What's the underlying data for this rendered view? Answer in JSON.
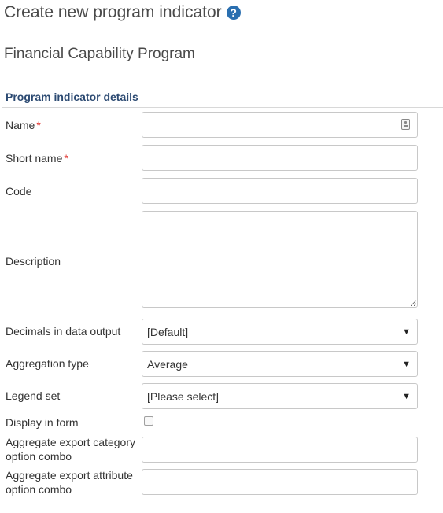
{
  "header": {
    "title": "Create new program indicator",
    "help_icon_glyph": "?"
  },
  "program": {
    "name": "Financial Capability Program"
  },
  "section": {
    "title": "Program indicator details"
  },
  "form": {
    "name": {
      "label": "Name",
      "required_mark": "*",
      "value": ""
    },
    "short_name": {
      "label": "Short name",
      "required_mark": "*",
      "value": ""
    },
    "code": {
      "label": "Code",
      "value": ""
    },
    "description": {
      "label": "Description",
      "value": ""
    },
    "decimals": {
      "label": "Decimals in data output",
      "selected": "[Default]"
    },
    "aggregation_type": {
      "label": "Aggregation type",
      "selected": "Average"
    },
    "legend_set": {
      "label": "Legend set",
      "selected": "[Please select]"
    },
    "display_in_form": {
      "label": "Display in form",
      "checked": false
    },
    "agg_export_category": {
      "label": "Aggregate export category option combo",
      "value": ""
    },
    "agg_export_attribute": {
      "label": "Aggregate export attribute option combo",
      "value": ""
    }
  },
  "icons": {
    "help": "question-circle-icon",
    "translate": "translate-icon",
    "dropdown": "chevron-down-icon"
  },
  "colors": {
    "section_header": "#2c4a72",
    "help_icon": "#2a6fb0",
    "required": "#e0302b",
    "border": "#c8c8c8"
  }
}
